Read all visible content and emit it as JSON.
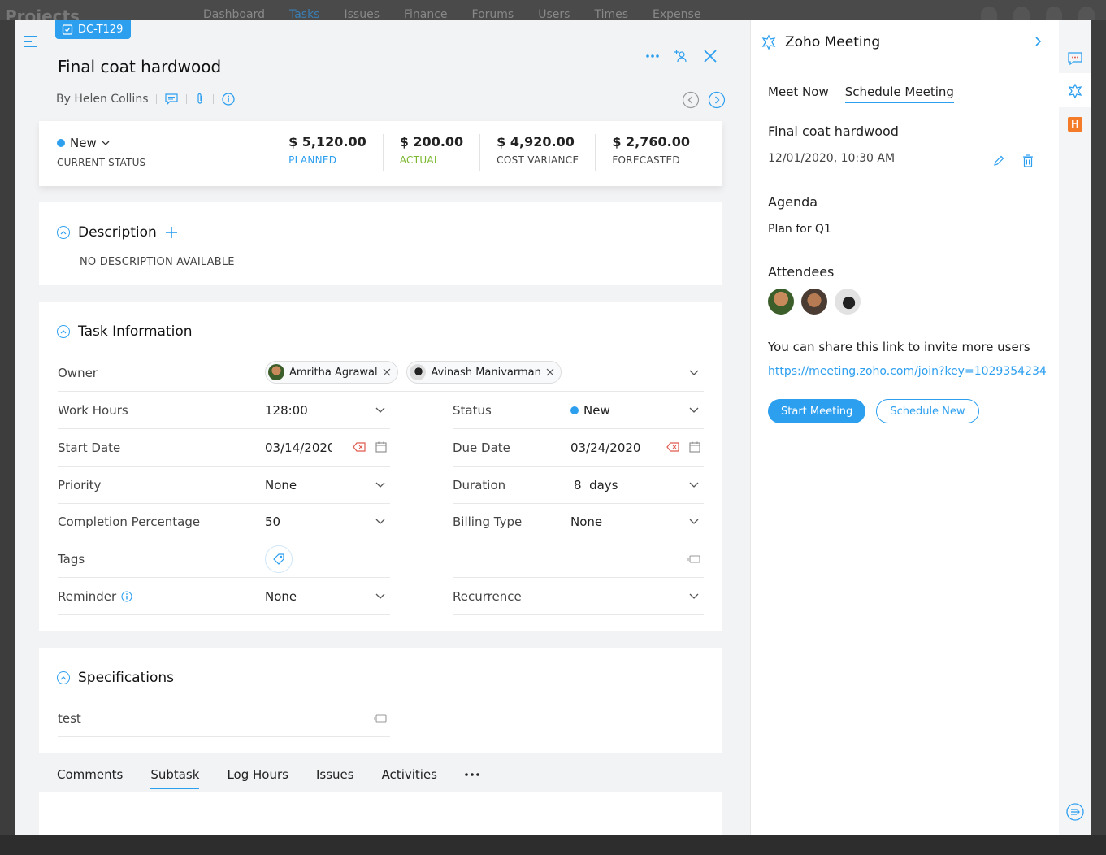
{
  "background": {
    "logo": "Projects",
    "nav": [
      "Dashboard",
      "Tasks",
      "Issues",
      "Finance",
      "Forums",
      "Users",
      "Times",
      "Expense"
    ]
  },
  "task": {
    "id": "DC-T129",
    "title": "Final coat hardwood",
    "byline": "By Helen Collins"
  },
  "status": {
    "value": "New",
    "label": "CURRENT STATUS",
    "color": "#2d9fef"
  },
  "costs": [
    {
      "amount": "$ 5,120.00",
      "label": "PLANNED",
      "color": "#2d9fef"
    },
    {
      "amount": "$ 200.00",
      "label": "ACTUAL",
      "color": "#7cb82f"
    },
    {
      "amount": "$ 4,920.00",
      "label": "COST VARIANCE",
      "color": "#444444"
    },
    {
      "amount": "$ 2,760.00",
      "label": "FORECASTED",
      "color": "#444444"
    }
  ],
  "description": {
    "title": "Description",
    "empty_text": "NO DESCRIPTION AVAILABLE"
  },
  "task_info": {
    "title": "Task Information",
    "owner_label": "Owner",
    "owners": [
      "Amritha Agrawal",
      "Avinash Manivarman"
    ],
    "work_hours_label": "Work Hours",
    "work_hours": "128:00",
    "status_label": "Status",
    "status_value": "New",
    "start_date_label": "Start Date",
    "start_date": "03/14/2020",
    "due_date_label": "Due Date",
    "due_date": "03/24/2020",
    "priority_label": "Priority",
    "priority": "None",
    "duration_label": "Duration",
    "duration": "8  days",
    "completion_label": "Completion Percentage",
    "completion": "50",
    "billing_label": "Billing Type",
    "billing": "None",
    "tags_label": "Tags",
    "reminder_label": "Reminder",
    "reminder": "None",
    "recurrence_label": "Recurrence"
  },
  "specifications": {
    "title": "Specifications",
    "value": "test"
  },
  "tabs": [
    "Comments",
    "Subtask",
    "Log Hours",
    "Issues",
    "Activities"
  ],
  "active_tab": "Subtask",
  "meeting": {
    "panel_title": "Zoho Meeting",
    "tabs": [
      "Meet Now",
      "Schedule Meeting"
    ],
    "active_tab": "Schedule Meeting",
    "title": "Final coat hardwood",
    "datetime": "12/01/2020, 10:30 AM",
    "agenda_label": "Agenda",
    "agenda": "Plan for Q1",
    "attendees_label": "Attendees",
    "share_text": "You can share this link to invite more users",
    "link": "https://meeting.zoho.com/join?key=1029354234",
    "start_button": "Start Meeting",
    "schedule_button": "Schedule New"
  },
  "rail": {
    "badge_letter": "H"
  }
}
